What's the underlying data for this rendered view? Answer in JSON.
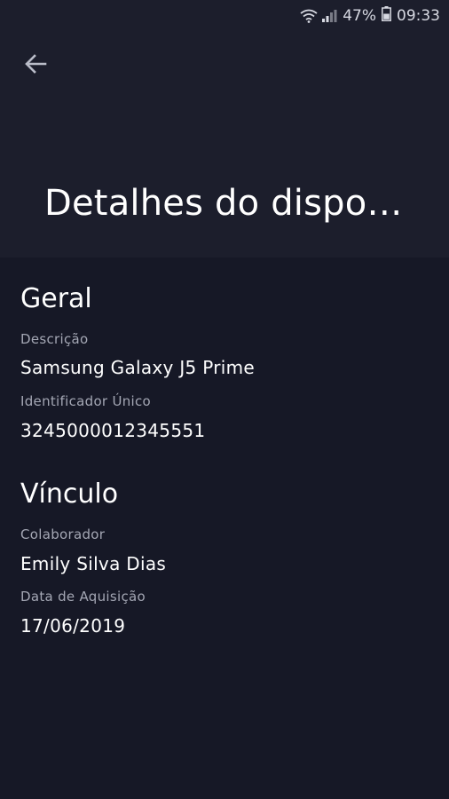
{
  "status_bar": {
    "battery": "47%",
    "time": "09:33",
    "icons": [
      "wifi-icon",
      "signal-icon",
      "battery-icon"
    ]
  },
  "header": {
    "back_icon": "arrow-left-icon",
    "title": "Detalhes do dispo…"
  },
  "sections": {
    "geral": {
      "title": "Geral",
      "descricao_label": "Descrição",
      "descricao_value": "Samsung Galaxy J5 Prime",
      "identificador_label": "Identificador Único",
      "identificador_value": "3245000012345551"
    },
    "vinculo": {
      "title": "Vínculo",
      "colaborador_label": "Colaborador",
      "colaborador_value": "Emily Silva Dias",
      "data_label": "Data de Aquisição",
      "data_value": "17/06/2019"
    }
  },
  "colors": {
    "background": "#161826",
    "appbar": "#1c1e2c",
    "label": "#a4a7b4",
    "text": "#ffffff"
  }
}
